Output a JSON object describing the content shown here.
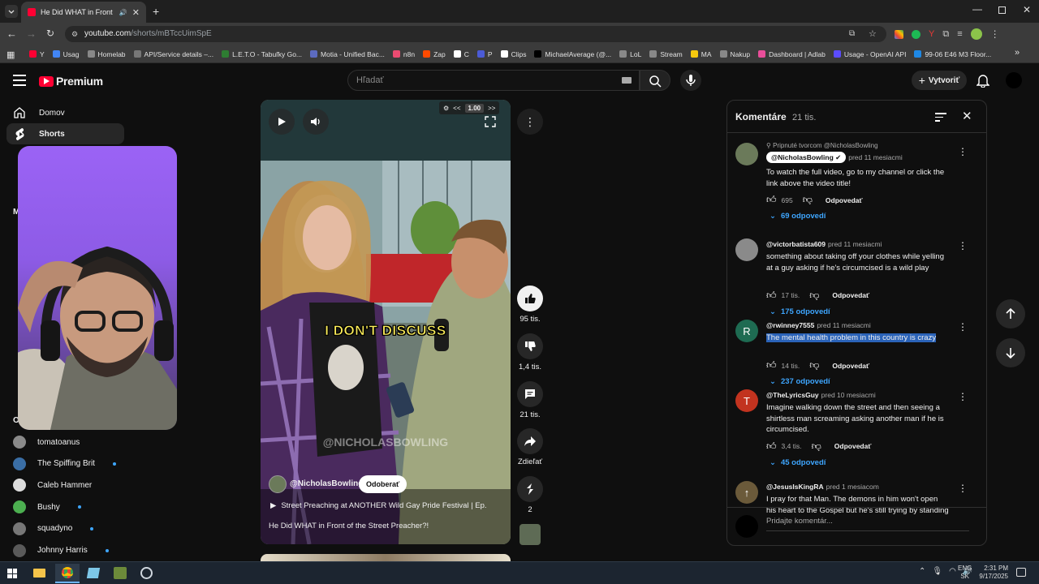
{
  "browser": {
    "tab_title": "He Did WHAT in Front of the",
    "url_host": "youtube.com",
    "url_path": "/shorts/mBTccUimSpE",
    "bookmarks": [
      {
        "label": "Y",
        "color": "#ff0033"
      },
      {
        "label": "Usag",
        "color": "#4285f4"
      },
      {
        "label": "Homelab",
        "color": "#888888"
      },
      {
        "label": "API/Service details –...",
        "color": "#777777"
      },
      {
        "label": "L.E.T.O - Tabuľky Go...",
        "color": "#2e7d32"
      },
      {
        "label": "Motia - Unified Bac...",
        "color": "#5c6bc0"
      },
      {
        "label": "n8n",
        "color": "#ea4b71"
      },
      {
        "label": "Zap",
        "color": "#ff4a00"
      },
      {
        "label": "C",
        "color": "#ffffff"
      },
      {
        "label": "P",
        "color": "#4b5bd6"
      },
      {
        "label": "Clips",
        "color": "#ffffff"
      },
      {
        "label": "MichaelAverage (@...",
        "color": "#000000"
      },
      {
        "label": "LoL",
        "color": "#888888"
      },
      {
        "label": "Stream",
        "color": "#888888"
      },
      {
        "label": "MA",
        "color": "#f6c90e"
      },
      {
        "label": "Nakup",
        "color": "#888888"
      },
      {
        "label": "Dashboard | Adlab",
        "color": "#e94e9a"
      },
      {
        "label": "Usage - OpenAI API",
        "color": "#5b4cff"
      },
      {
        "label": "99-06 E46 M3 Floor...",
        "color": "#1e88e5"
      }
    ]
  },
  "youtube": {
    "logo_text": "Premium",
    "search_placeholder": "Hľadať",
    "create_label": "Vytvoriť",
    "nav": [
      {
        "label": "Domov"
      },
      {
        "label": "Shorts"
      }
    ],
    "section_fragment_m": "M",
    "section_fragment_o": "Od",
    "subscriptions": [
      {
        "name": "tomatoanus",
        "dot": false,
        "color": "#8a8a8a"
      },
      {
        "name": "The Spiffing Brit",
        "dot": true,
        "color": "#3a6ea5"
      },
      {
        "name": "Caleb Hammer",
        "dot": false,
        "color": "#dddddd"
      },
      {
        "name": "Bushy",
        "dot": true,
        "color": "#4caf50"
      },
      {
        "name": "squadyno",
        "dot": true,
        "color": "#777777"
      },
      {
        "name": "Johnny Harris",
        "dot": true,
        "color": "#5a5a5a"
      }
    ]
  },
  "short": {
    "speed": "1.00",
    "caption": "I DON'T DISCUSS",
    "watermark": "@NICHOLASBOWLING",
    "channel": "@NicholasBowling",
    "subscribe_label": "Odoberať",
    "playlist": "Street Preaching at ANOTHER Wild Gay Pride Festival | Ep.",
    "title": "He Did WHAT in Front of the Street Preacher?!",
    "likes": "95 tis.",
    "dislikes": "1,4 tis.",
    "comments_count": "21 tis.",
    "share_label": "Zdieľať",
    "remix_count": "2"
  },
  "comments": {
    "title": "Komentáre",
    "count": "21 tis.",
    "add_placeholder": "Pridajte komentár...",
    "pinned_label": "Pripnuté tvorcom @NicholasBowling",
    "reply_label": "Odpovedať",
    "items": [
      {
        "user": "@NicholasBowling",
        "time": "pred 11 mesiacmi",
        "text": "To watch the full video, go to my channel or click the link above the video title!",
        "likes": "695",
        "replies": "69 odpovedí",
        "avatar_letter": "",
        "avatar_color": "#6b7a5a"
      },
      {
        "user": "@victorbatista609",
        "time": "pred 11 mesiacmi",
        "text": "something about taking off your clothes while yelling at a guy asking if he's circumcised is a wild play",
        "likes": "17 tis.",
        "replies": "175 odpovedí",
        "avatar_letter": "",
        "avatar_color": "#8a8a8a"
      },
      {
        "user": "@rwinney7555",
        "time": "pred 11 mesiacmi",
        "text": "The mental health problem in this country is crazy",
        "likes": "14 tis.",
        "replies": "237 odpovedí",
        "avatar_letter": "R",
        "avatar_color": "#1e6b52"
      },
      {
        "user": "@TheLyricsGuy",
        "time": "pred 10 mesiacmi",
        "text": "Imagine walking down the street and then seeing a shirtless man screaming asking another man if he is circumcised.",
        "likes": "3,4 tis.",
        "replies": "45 odpovedí",
        "avatar_letter": "T",
        "avatar_color": "#c2331f"
      },
      {
        "user": "@JesusIsKingRA",
        "time": "pred 1 mesiacom",
        "text": "I pray for that Man. The demons in him won't open his heart to the Gospel but he's still trying by standing",
        "likes": "",
        "replies": "",
        "avatar_letter": "↑",
        "avatar_color": "#6b5a3a"
      }
    ]
  },
  "taskbar": {
    "lang": "ENG",
    "region": "SK",
    "time": "2:31 PM",
    "date": "9/17/2025"
  }
}
